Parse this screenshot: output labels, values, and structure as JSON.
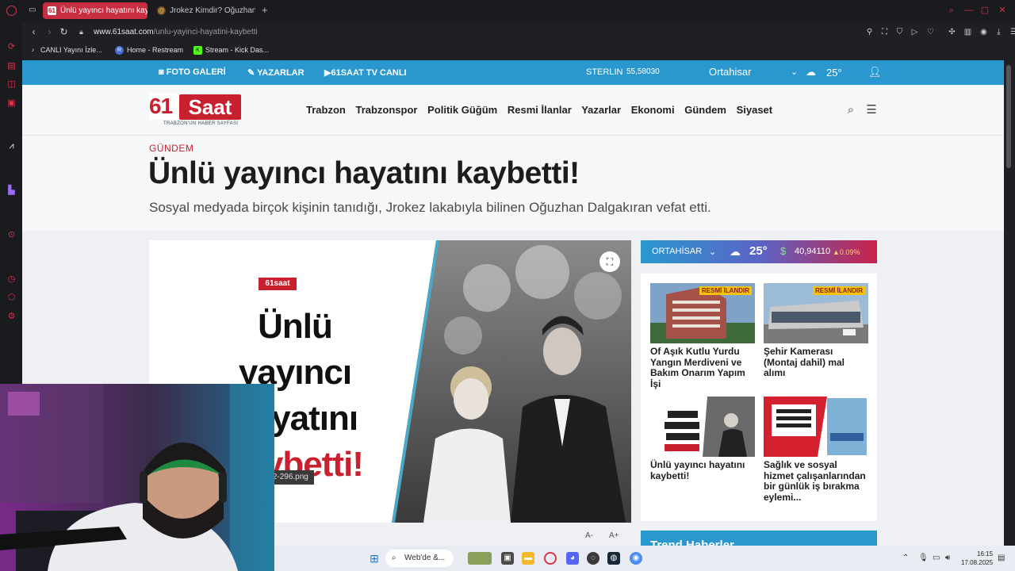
{
  "browser": {
    "tabs": [
      {
        "label": "Ünlü yayıncı hayatını kaybett",
        "favicon": "61"
      },
      {
        "label": "Jrokez Kimdir? Oğuzhan Da",
        "favicon": "@"
      }
    ],
    "url_domain": "www.61saat.com",
    "url_path": "/unlu-yayinci-hayatini-kaybetti",
    "bookmarks": [
      {
        "label": "CANLI Yayını İzle..."
      },
      {
        "label": "Home - Restream"
      },
      {
        "label": "Stream - Kick Das..."
      }
    ]
  },
  "site": {
    "top_links": {
      "photo_gallery": "FOTO GALERİ",
      "writers": "YAZARLAR",
      "tv": "61SAAT TV CANLI"
    },
    "currency_label": "STERLIN",
    "currency_value": "55,58030",
    "city": "Ortahisar",
    "temperature": "25°",
    "logo_number": "61",
    "logo_word": "Saat",
    "logo_tagline": "TRABZON'UN HABER SAYFASI",
    "nav": [
      "Trabzon",
      "Trabzonspor",
      "Politik Güğüm",
      "Resmi İlanlar",
      "Yazarlar",
      "Ekonomi",
      "Gündem",
      "Siyaset"
    ]
  },
  "article": {
    "category": "GÜNDEM",
    "headline": "Ünlü yayıncı hayatını kaybetti!",
    "subheadline": "Sosyal medyada birçok kişinin tanıdığı, Jrokez lakabıyla bilinen Oğuzhan Dalgakıran vefat etti.",
    "image_logo": "61saat",
    "image_text_lines": [
      "Ünlü",
      "yayıncı",
      "hayatını",
      "kaybetti!"
    ],
    "image_filename": "5/08/12-296.png",
    "font_smaller": "A-",
    "font_larger": "A+"
  },
  "sidebar": {
    "city": "ORTAHİSAR",
    "temperature": "25°",
    "dollar_value": "40,94110",
    "dollar_change": "0.09%",
    "cards": [
      {
        "badge": "RESMİ İLANDIR",
        "title": "Of Aşık Kutlu Yurdu Yangın Merdiveni ve Bakım Onarım Yapım İşi"
      },
      {
        "badge": "RESMİ İLANDIR",
        "title": "Şehir Kamerası (Montaj dahil) mal alımı"
      },
      {
        "badge": "",
        "title": "Ünlü yayıncı hayatını kaybetti!"
      },
      {
        "badge": "",
        "title": "Sağlık ve sosyal hizmet çalışanlarından bir günlük iş bırakma eylemi..."
      }
    ],
    "bottom_title": "Trend Haberler"
  },
  "taskbar": {
    "search_placeholder": "Web'de &...",
    "time": "16:15",
    "date": "17.08.2025"
  },
  "colors": {
    "brand_red": "#c8202f",
    "brand_blue": "#2a98cf",
    "tab_active": "#c82e41",
    "chrome_bg": "#1a1b1f"
  }
}
